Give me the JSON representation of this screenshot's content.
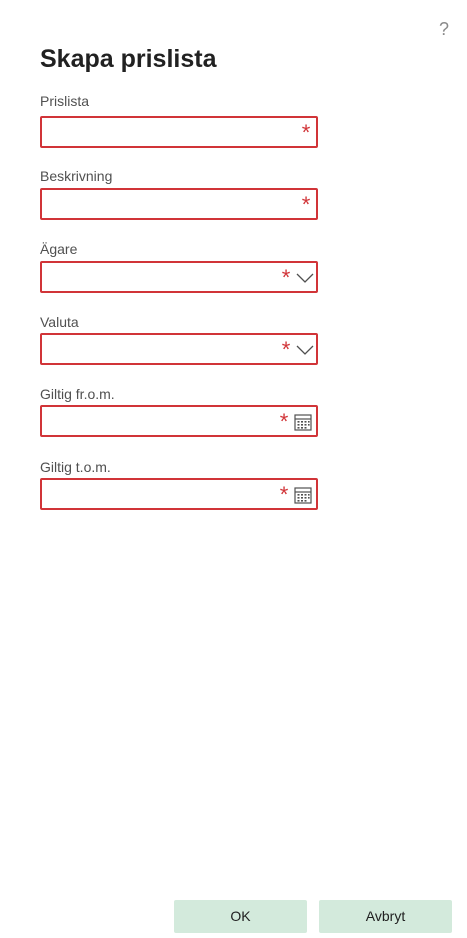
{
  "dialog": {
    "title": "Skapa prislista",
    "help_label": "?"
  },
  "fields": [
    {
      "label": "Prislista",
      "value": "",
      "required_mark": "*",
      "control": "text"
    },
    {
      "label": "Beskrivning",
      "value": "",
      "required_mark": "*",
      "control": "text"
    },
    {
      "label": "Ägare",
      "value": "",
      "required_mark": "*",
      "control": "dropdown",
      "icon": "chevron-down-icon"
    },
    {
      "label": "Valuta",
      "value": "",
      "required_mark": "*",
      "control": "dropdown",
      "icon": "chevron-down-icon"
    },
    {
      "label": "Giltig fr.o.m.",
      "value": "",
      "required_mark": "*",
      "control": "date",
      "icon": "calendar-icon"
    },
    {
      "label": "Giltig t.o.m.",
      "value": "",
      "required_mark": "*",
      "control": "date",
      "icon": "calendar-icon"
    }
  ],
  "actions": {
    "ok_label": "OK",
    "cancel_label": "Avbryt"
  },
  "colors": {
    "error_border": "#d13438",
    "button_bg": "#d3eadc",
    "text": "#212121"
  }
}
